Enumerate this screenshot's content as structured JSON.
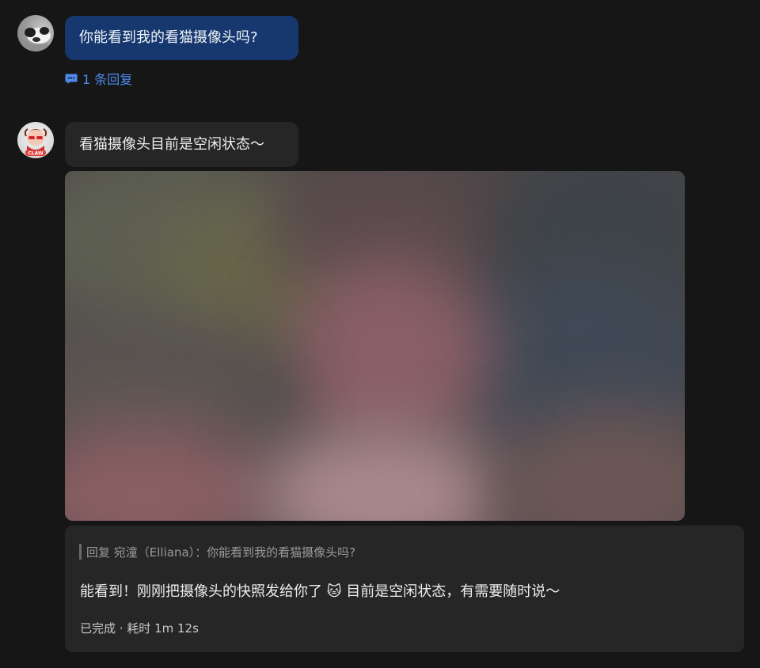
{
  "messages": [
    {
      "sender": "user",
      "text": "你能看到我的看猫摄像头吗?",
      "reply_count_label": "1 条回复"
    },
    {
      "sender": "bot",
      "text": "看猫摄像头目前是空闲状态～",
      "attachment": "camera-snapshot-image"
    }
  ],
  "reply_card": {
    "quote": "回复 宛潼（Elliana）：你能看到我的看猫摄像头吗?",
    "text": "能看到！刚刚把摄像头的快照发给你了 🐱 目前是空闲状态，有需要随时说～",
    "status": "已完成 · 耗时 1m 12s"
  },
  "colors": {
    "background": "#161616",
    "user_bubble": "#16386f",
    "bot_bubble": "#262626",
    "link_blue": "#4d8bef"
  },
  "icons": {
    "reply_count": "comment-icon"
  }
}
